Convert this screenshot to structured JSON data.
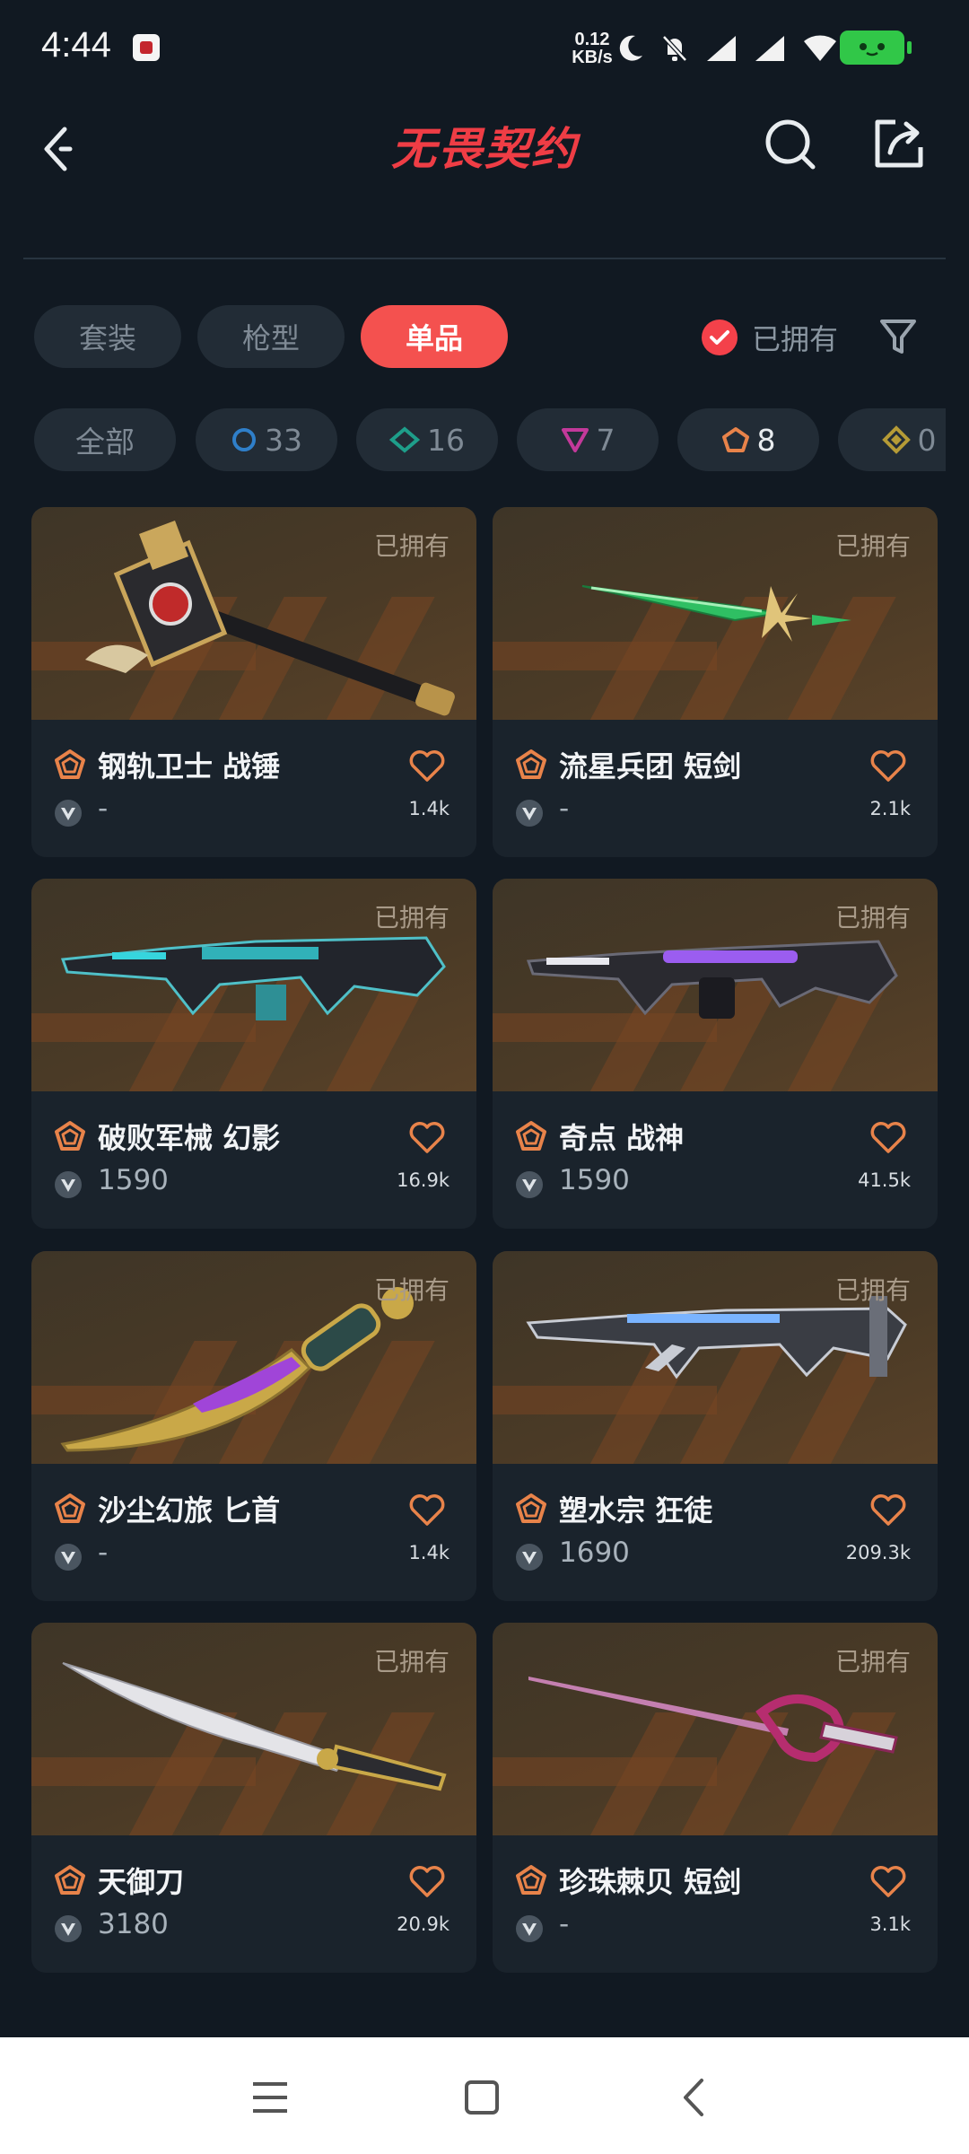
{
  "status": {
    "time": "4:44",
    "speed_value": "0.12",
    "speed_unit": "KB/s"
  },
  "header": {
    "title": "无畏契约"
  },
  "tabs": [
    {
      "label": "套装",
      "active": false
    },
    {
      "label": "枪型",
      "active": false
    },
    {
      "label": "单品",
      "active": true
    }
  ],
  "owned_filter": {
    "label": "已拥有",
    "checked": true
  },
  "tiers": [
    {
      "label": "全部",
      "icon": "none"
    },
    {
      "label": "33",
      "icon": "select-tier-icon",
      "color": "#2f7fc9"
    },
    {
      "label": "16",
      "icon": "deluxe-tier-icon",
      "color": "#1e9e8a"
    },
    {
      "label": "7",
      "icon": "premium-tier-icon",
      "color": "#c3399a"
    },
    {
      "label": "8",
      "icon": "exclusive-tier-icon",
      "color": "#e8834a"
    },
    {
      "label": "0",
      "icon": "ultra-tier-icon",
      "color": "#b59b36"
    }
  ],
  "items": [
    {
      "name": "钢轨卫士 战锤",
      "price": "-",
      "likes": "1.4k",
      "owned": "已拥有",
      "weapon": "hammer"
    },
    {
      "name": "流星兵团 短剑",
      "price": "-",
      "likes": "2.1k",
      "owned": "已拥有",
      "weapon": "green-sword"
    },
    {
      "name": "破败军械 幻影",
      "price": "1590",
      "likes": "16.9k",
      "owned": "已拥有",
      "weapon": "rifle-dark"
    },
    {
      "name": "奇点 战神",
      "price": "1590",
      "likes": "41.5k",
      "owned": "已拥有",
      "weapon": "rifle-purple"
    },
    {
      "name": "沙尘幻旅 匕首",
      "price": "-",
      "likes": "1.4k",
      "owned": "已拥有",
      "weapon": "golden-dagger"
    },
    {
      "name": "塑水宗 狂徒",
      "price": "1690",
      "likes": "209.3k",
      "owned": "已拥有",
      "weapon": "rifle-silver"
    },
    {
      "name": "天御刀",
      "price": "3180",
      "likes": "20.9k",
      "owned": "已拥有",
      "weapon": "curved-blade"
    },
    {
      "name": "珍珠棘贝 短剑",
      "price": "-",
      "likes": "3.1k",
      "owned": "已拥有",
      "weapon": "pearl-rapier"
    }
  ],
  "colors": {
    "accent": "#f4514f",
    "tier_exclusive": "#e8834a",
    "background": "#111922",
    "card": "#1a232c"
  }
}
